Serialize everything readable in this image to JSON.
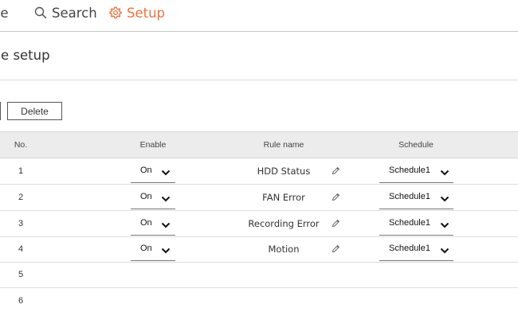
{
  "nav": {
    "live_label": "ive",
    "search_label": "Search",
    "setup_label": "Setup",
    "active_color": "#e9733c"
  },
  "page": {
    "title": "ule setup"
  },
  "toolbar": {
    "delete_label": "Delete"
  },
  "table": {
    "headers": {
      "no": "No.",
      "enable": "Enable",
      "rule_name": "Rule name",
      "schedule": "Schedule"
    },
    "rows": [
      {
        "no": "1",
        "enable": "On",
        "rule_name": "HDD Status",
        "schedule": "Schedule1"
      },
      {
        "no": "2",
        "enable": "On",
        "rule_name": "FAN Error",
        "schedule": "Schedule1"
      },
      {
        "no": "3",
        "enable": "On",
        "rule_name": "Recording Error",
        "schedule": "Schedule1"
      },
      {
        "no": "4",
        "enable": "On",
        "rule_name": "Motion",
        "schedule": "Schedule1"
      },
      {
        "no": "5"
      },
      {
        "no": "6"
      }
    ]
  },
  "icons": {
    "search": "search-icon",
    "setup": "gear-icon",
    "edit": "pencil-icon",
    "dropdown": "chevron-down-icon"
  }
}
